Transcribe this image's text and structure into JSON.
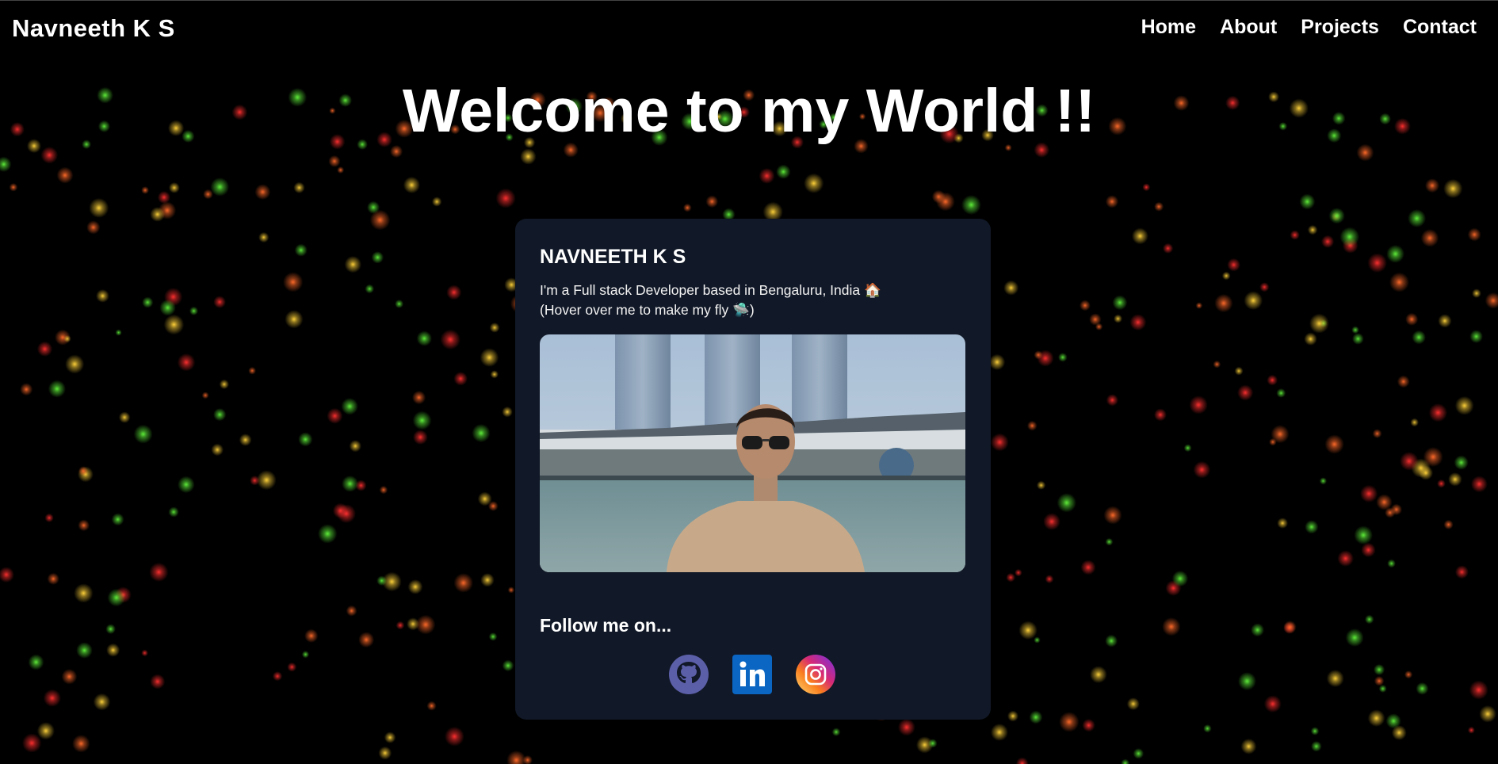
{
  "header": {
    "brand": "Navneeth K S",
    "nav": [
      {
        "label": "Home"
      },
      {
        "label": "About"
      },
      {
        "label": "Projects"
      },
      {
        "label": "Contact"
      }
    ]
  },
  "hero": {
    "title": "Welcome to my World !!"
  },
  "card": {
    "name": "NAVNEETH K S",
    "bio_line1": "I'm a Full stack Developer based in Bengaluru, India 🏠",
    "bio_line2": "(Hover over me to make my fly 🛸)",
    "photo_icon": "profile-photo",
    "follow_label": "Follow me on...",
    "socials": [
      {
        "icon": "github-icon",
        "color": "#5b5fa8"
      },
      {
        "icon": "linkedin-icon",
        "color": "#0a66c2"
      },
      {
        "icon": "instagram-icon",
        "color": "#e1306c"
      }
    ]
  },
  "colors": {
    "background": "#000000",
    "card": "#111827",
    "text": "#ffffff",
    "particles": [
      "#ffd23a",
      "#5ff03a",
      "#ff6a2a",
      "#ff3030"
    ]
  }
}
